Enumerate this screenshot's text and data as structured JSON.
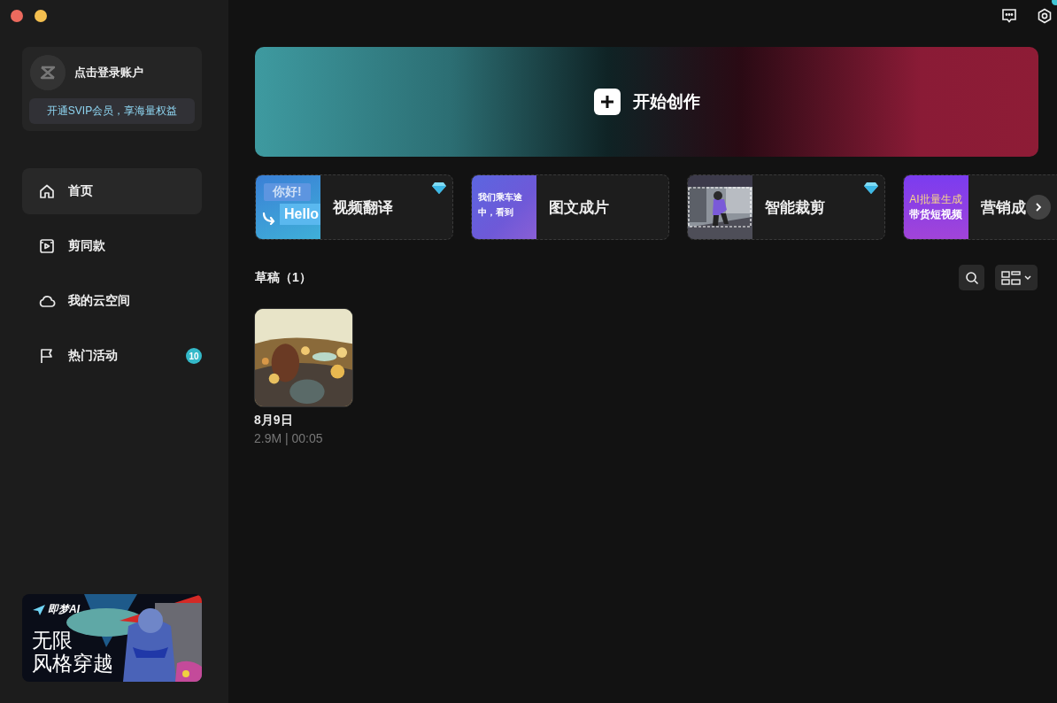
{
  "account": {
    "name": "点击登录账户",
    "vip_button": "开通SVIP会员，享海量权益"
  },
  "nav": [
    {
      "label": "首页",
      "selected": true
    },
    {
      "label": "剪同款",
      "selected": false
    },
    {
      "label": "我的云空间",
      "selected": false
    },
    {
      "label": "热门活动",
      "selected": false,
      "badge": "10"
    }
  ],
  "promo_banner": {
    "kind": "picture",
    "logo": "即梦AI",
    "headline": [
      "无限",
      "风格穿越"
    ]
  },
  "start_button": {
    "label": "开始创作"
  },
  "tools": [
    {
      "title": "视频翻译",
      "premium": true,
      "thumb": {
        "kind": "translate",
        "lines": [
          "你好!",
          "Hello"
        ]
      }
    },
    {
      "title": "图文成片",
      "premium": false,
      "thumb": {
        "kind": "text",
        "lines": [
          "我们乘车途",
          "中，看到"
        ]
      }
    },
    {
      "title": "智能裁剪",
      "premium": true
    },
    {
      "title": "营销成",
      "thumb": {
        "kind": "promo",
        "lines": [
          "AI批量生成",
          "带货短视频"
        ]
      }
    }
  ],
  "drafts": {
    "title": "草稿（1）",
    "items": [
      {
        "title": "8月9日",
        "meta": "2.9M | 00:05"
      }
    ]
  }
}
